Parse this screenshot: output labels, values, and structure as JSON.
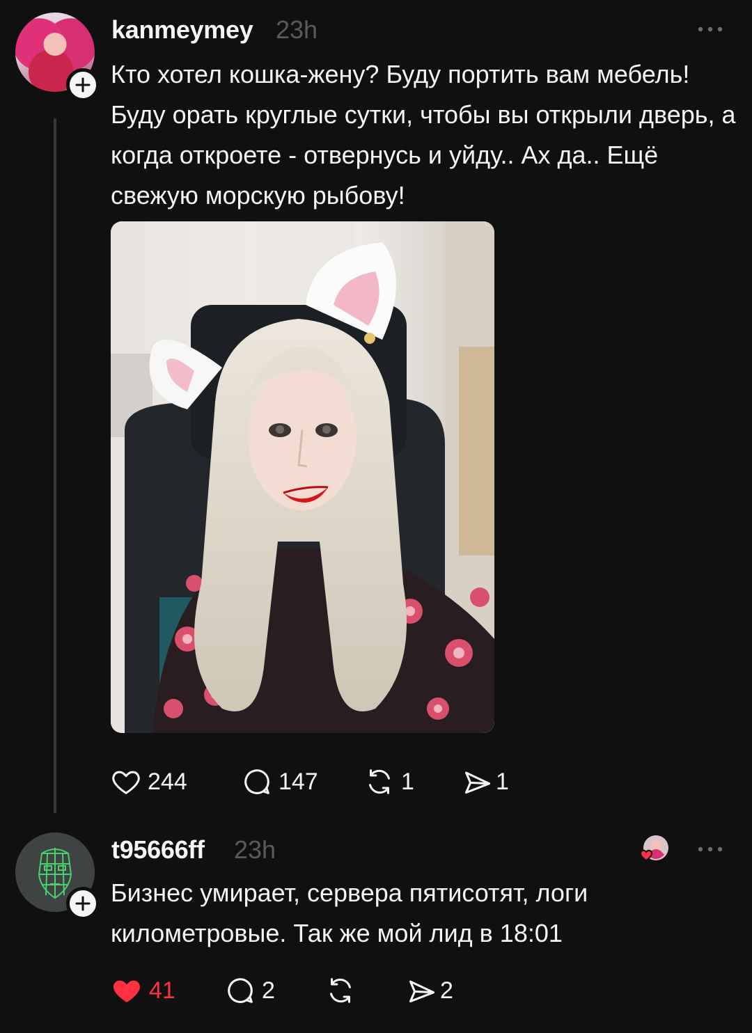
{
  "colors": {
    "background": "#101010",
    "text_primary": "#f3f5f7",
    "text_secondary": "#5a5a5a",
    "like_active": "#ff3040",
    "thread_line": "#3a3a3a"
  },
  "posts": [
    {
      "username": "kanmeymey",
      "timestamp": "23h",
      "text": "Кто хотел кошка-жену? Буду  портить вам мебель! Буду орать круглые сутки, чтобы вы открыли дверь, а когда откроете - отвернусь и уйду.. Ах да.. Ещё свежую морскую рыбову!",
      "has_image": true,
      "actions": {
        "likes": "244",
        "comments": "147",
        "reposts": "1",
        "shares": "1",
        "liked": false
      },
      "icons": [
        "heart-icon",
        "comment-icon",
        "repost-icon",
        "share-icon",
        "more-icon",
        "follow-plus-icon"
      ]
    },
    {
      "username": "t95666ff",
      "timestamp": "23h",
      "text": "Бизнес умирает, сервера пятисотят, логи километровые. Так же мой лид в 18:01",
      "has_image": false,
      "actions": {
        "likes": "41",
        "comments": "2",
        "reposts": "",
        "shares": "2",
        "liked": true
      },
      "icons": [
        "heart-filled-icon",
        "comment-icon",
        "repost-icon",
        "share-icon",
        "more-icon",
        "follow-plus-icon",
        "liked-by-author-icon"
      ]
    }
  ]
}
